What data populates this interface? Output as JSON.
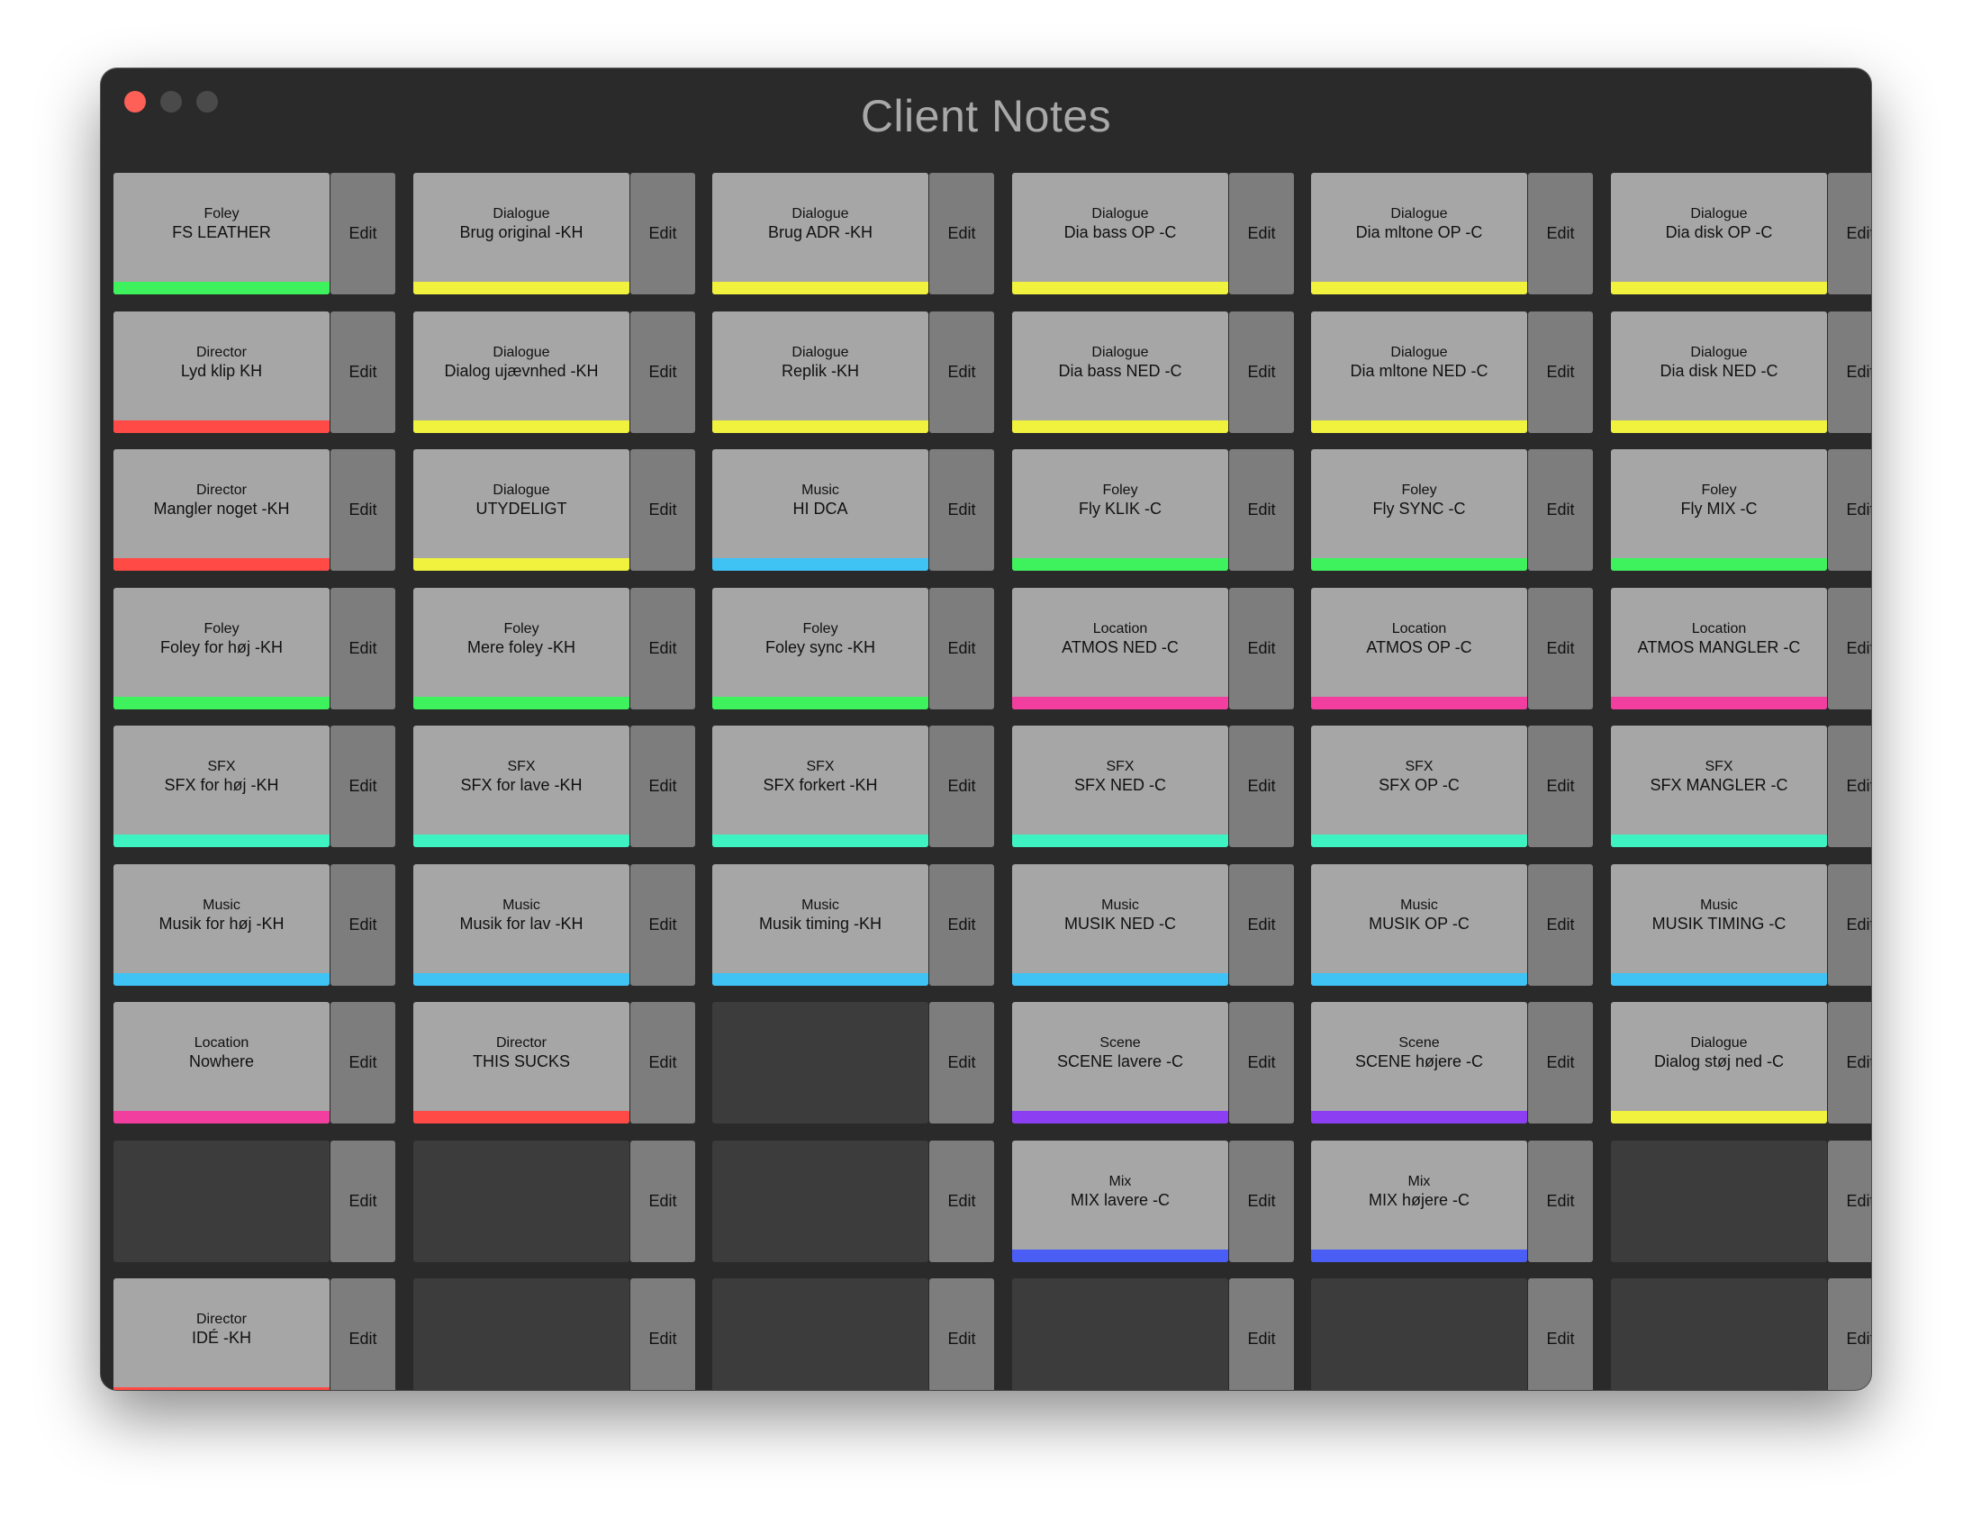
{
  "window": {
    "title": "Client Notes",
    "controls": [
      "close",
      "minimize",
      "zoom"
    ]
  },
  "colors": {
    "green": "#3ef25e",
    "yellow": "#f0f23e",
    "red": "#ff4a45",
    "blue": "#3fc3f5",
    "pink": "#f23e9f",
    "teal": "#3ef2c2",
    "purple": "#8c3ef2",
    "indigo": "#4a5ef5"
  },
  "edit_label": "Edit",
  "grid": {
    "columns": 6,
    "rows": 9,
    "cells": [
      {
        "category": "Foley",
        "label": "FS LEATHER",
        "color": "green"
      },
      {
        "category": "Dialogue",
        "label": "Brug original -KH",
        "color": "yellow"
      },
      {
        "category": "Dialogue",
        "label": "Brug ADR -KH",
        "color": "yellow"
      },
      {
        "category": "Dialogue",
        "label": "Dia bass OP -C",
        "color": "yellow"
      },
      {
        "category": "Dialogue",
        "label": "Dia mltone OP -C",
        "color": "yellow"
      },
      {
        "category": "Dialogue",
        "label": "Dia disk OP -C",
        "color": "yellow"
      },
      {
        "category": "Director",
        "label": "Lyd klip KH",
        "color": "red"
      },
      {
        "category": "Dialogue",
        "label": "Dialog ujævnhed -KH",
        "color": "yellow"
      },
      {
        "category": "Dialogue",
        "label": "Replik -KH",
        "color": "yellow"
      },
      {
        "category": "Dialogue",
        "label": "Dia bass NED -C",
        "color": "yellow"
      },
      {
        "category": "Dialogue",
        "label": "Dia mltone NED -C",
        "color": "yellow"
      },
      {
        "category": "Dialogue",
        "label": "Dia disk NED -C",
        "color": "yellow"
      },
      {
        "category": "Director",
        "label": "Mangler noget -KH",
        "color": "red"
      },
      {
        "category": "Dialogue",
        "label": "UTYDELIGT",
        "color": "yellow"
      },
      {
        "category": "Music",
        "label": "HI DCA",
        "color": "blue"
      },
      {
        "category": "Foley",
        "label": "Fly KLIK -C",
        "color": "green"
      },
      {
        "category": "Foley",
        "label": "Fly SYNC -C",
        "color": "green"
      },
      {
        "category": "Foley",
        "label": "Fly MIX -C",
        "color": "green"
      },
      {
        "category": "Foley",
        "label": "Foley for høj -KH",
        "color": "green"
      },
      {
        "category": "Foley",
        "label": "Mere foley -KH",
        "color": "green"
      },
      {
        "category": "Foley",
        "label": "Foley sync -KH",
        "color": "green"
      },
      {
        "category": "Location",
        "label": "ATMOS NED -C",
        "color": "pink"
      },
      {
        "category": "Location",
        "label": "ATMOS OP -C",
        "color": "pink"
      },
      {
        "category": "Location",
        "label": "ATMOS MANGLER -C",
        "color": "pink"
      },
      {
        "category": "SFX",
        "label": "SFX for høj -KH",
        "color": "teal"
      },
      {
        "category": "SFX",
        "label": "SFX for lave -KH",
        "color": "teal"
      },
      {
        "category": "SFX",
        "label": "SFX forkert -KH",
        "color": "teal"
      },
      {
        "category": "SFX",
        "label": "SFX NED -C",
        "color": "teal"
      },
      {
        "category": "SFX",
        "label": "SFX OP -C",
        "color": "teal"
      },
      {
        "category": "SFX",
        "label": "SFX MANGLER -C",
        "color": "teal"
      },
      {
        "category": "Music",
        "label": "Musik for høj -KH",
        "color": "blue"
      },
      {
        "category": "Music",
        "label": "Musik for lav -KH",
        "color": "blue"
      },
      {
        "category": "Music",
        "label": "Musik timing -KH",
        "color": "blue"
      },
      {
        "category": "Music",
        "label": "MUSIK NED -C",
        "color": "blue"
      },
      {
        "category": "Music",
        "label": "MUSIK OP -C",
        "color": "blue"
      },
      {
        "category": "Music",
        "label": "MUSIK TIMING -C",
        "color": "blue"
      },
      {
        "category": "Location",
        "label": "Nowhere",
        "color": "pink"
      },
      {
        "category": "Director",
        "label": "THIS SUCKS",
        "color": "red"
      },
      null,
      {
        "category": "Scene",
        "label": "SCENE lavere -C",
        "color": "purple"
      },
      {
        "category": "Scene",
        "label": "SCENE højere -C",
        "color": "purple"
      },
      {
        "category": "Dialogue",
        "label": "Dialog støj ned -C",
        "color": "yellow"
      },
      null,
      null,
      null,
      {
        "category": "Mix",
        "label": "MIX lavere -C",
        "color": "indigo"
      },
      {
        "category": "Mix",
        "label": "MIX højere -C",
        "color": "indigo"
      },
      null,
      {
        "category": "Director",
        "label": "IDÉ -KH",
        "color": "red"
      },
      null,
      null,
      null,
      null,
      null
    ]
  }
}
